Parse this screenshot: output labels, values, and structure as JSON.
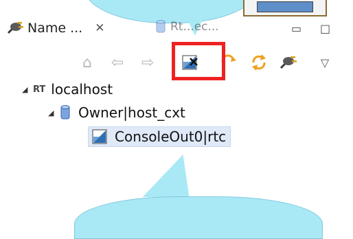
{
  "tabs": {
    "active_label": "Name ...",
    "close_glyph": "✕",
    "second_label": "Rt...ec...",
    "minimize_glyph": "▭",
    "maximize_glyph": "□"
  },
  "toolbar": {
    "home_glyph": "⌂",
    "back_glyph": "⇦",
    "forward_glyph": "⇨",
    "menu_glyph": "▽"
  },
  "tree": {
    "root": {
      "icon_text": "RT",
      "label": "localhost",
      "expanded": true
    },
    "owner": {
      "label": "Owner|host_cxt",
      "expanded": true
    },
    "component": {
      "label": "ConsoleOut0|rtc",
      "selected": true
    }
  },
  "colors": {
    "callout": "#a9e9f6",
    "highlight": "#ee2222",
    "selection": "#dfe9f7"
  }
}
